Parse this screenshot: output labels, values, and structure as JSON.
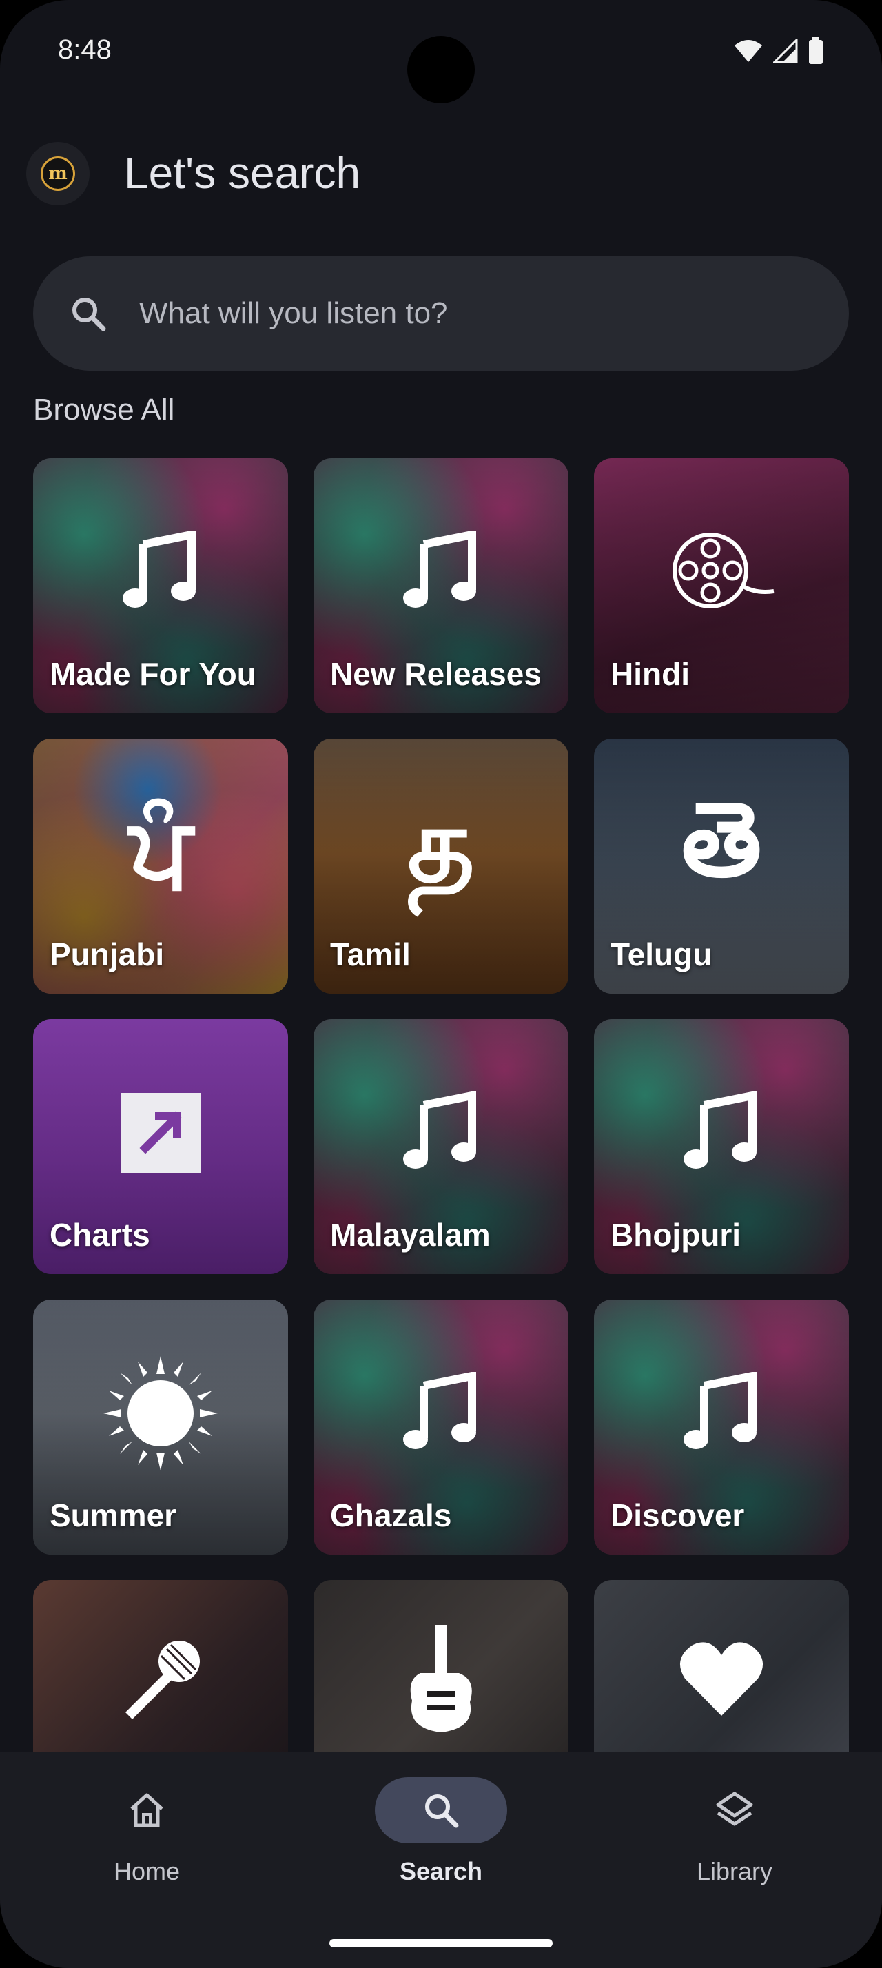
{
  "status_bar": {
    "time": "8:48"
  },
  "header": {
    "title": "Let's search",
    "logo_letter": "m"
  },
  "search": {
    "placeholder": "What will you listen to?"
  },
  "browse": {
    "title": "Browse All",
    "tiles": [
      {
        "label": "Made For You",
        "icon": "music-note-icon"
      },
      {
        "label": "New Releases",
        "icon": "music-note-icon"
      },
      {
        "label": "Hindi",
        "icon": "film-reel-icon"
      },
      {
        "label": "Punjabi",
        "icon": "gurmukhi-letter-icon",
        "glyph": "ਪੰ"
      },
      {
        "label": "Tamil",
        "icon": "tamil-letter-icon",
        "glyph": "த"
      },
      {
        "label": "Telugu",
        "icon": "telugu-letter-icon",
        "glyph": "తె"
      },
      {
        "label": "Charts",
        "icon": "trending-arrow-icon"
      },
      {
        "label": "Malayalam",
        "icon": "music-note-icon"
      },
      {
        "label": "Bhojpuri",
        "icon": "music-note-icon"
      },
      {
        "label": "Summer",
        "icon": "sun-icon"
      },
      {
        "label": "Ghazals",
        "icon": "music-note-icon"
      },
      {
        "label": "Discover",
        "icon": "music-note-icon"
      },
      {
        "label": "",
        "icon": "microphone-icon"
      },
      {
        "label": "",
        "icon": "guitar-icon"
      },
      {
        "label": "",
        "icon": "heart-icon"
      }
    ]
  },
  "nav": {
    "items": [
      {
        "label": "Home",
        "icon": "home-icon",
        "active": false
      },
      {
        "label": "Search",
        "icon": "search-icon",
        "active": true
      },
      {
        "label": "Library",
        "icon": "layers-icon",
        "active": false
      }
    ]
  },
  "colors": {
    "background": "#13141a",
    "search_bar": "#272930",
    "nav_active_pill": "#43485c",
    "charts_tile": "#7b3aa0"
  }
}
